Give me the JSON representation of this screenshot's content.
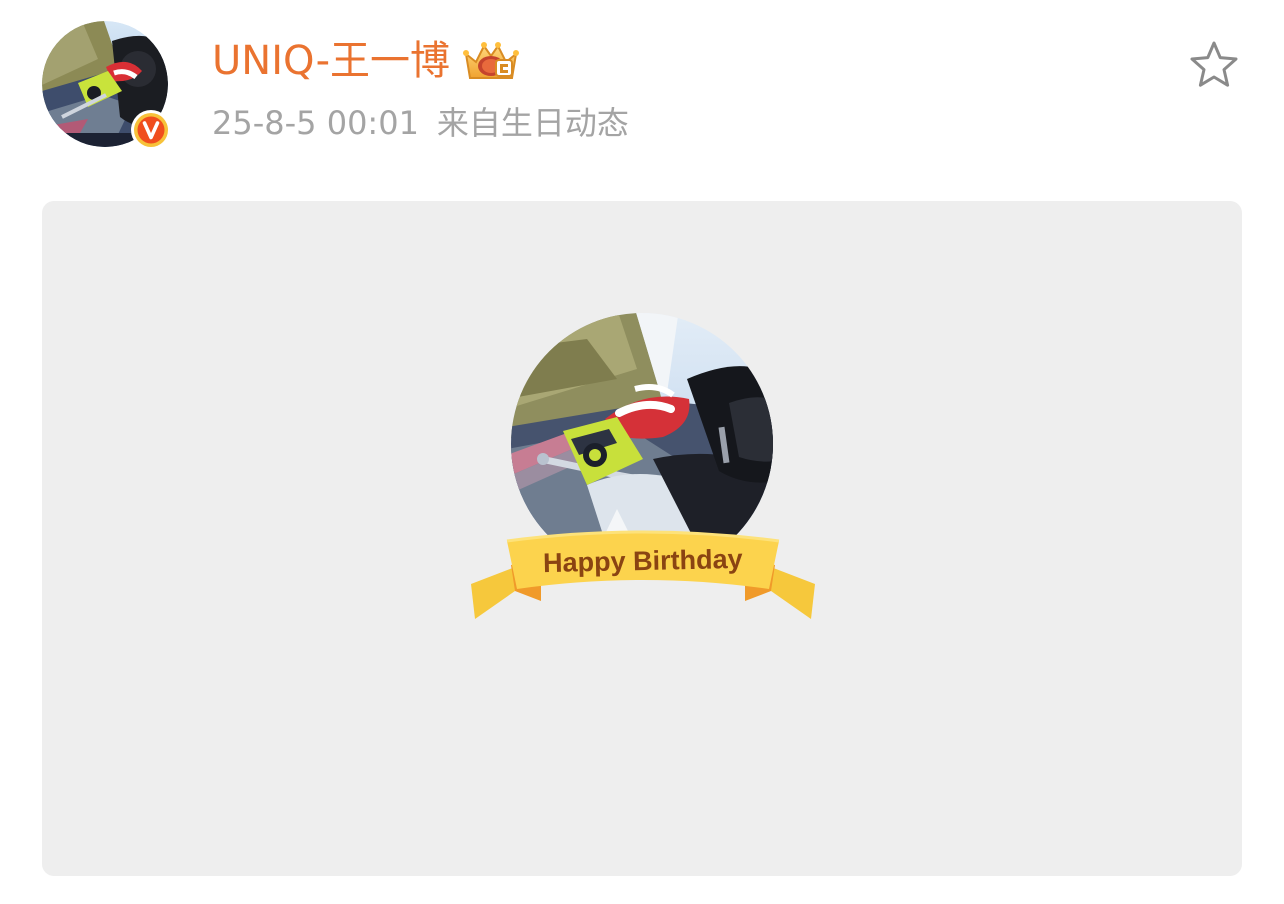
{
  "post": {
    "author": {
      "name": "UNIQ-王一博",
      "avatar_icon": "motorcycle-rider-photo",
      "verified_badge": "V",
      "verified_color": "#f04e1e",
      "membership_icon": "crown-icon"
    },
    "time": "25-8-5 00:01",
    "source": "来自生日动态",
    "favorite_icon": "star-outline-icon"
  },
  "card": {
    "background": "#eeeeee",
    "ribbon_text": "Happy Birthday",
    "ribbon_color": "#fcd34d",
    "ribbon_text_color": "#8a4412",
    "photo_icon": "motorcycle-rider-photo"
  },
  "colors": {
    "username": "#ea7330",
    "meta": "#a4a4a4"
  }
}
